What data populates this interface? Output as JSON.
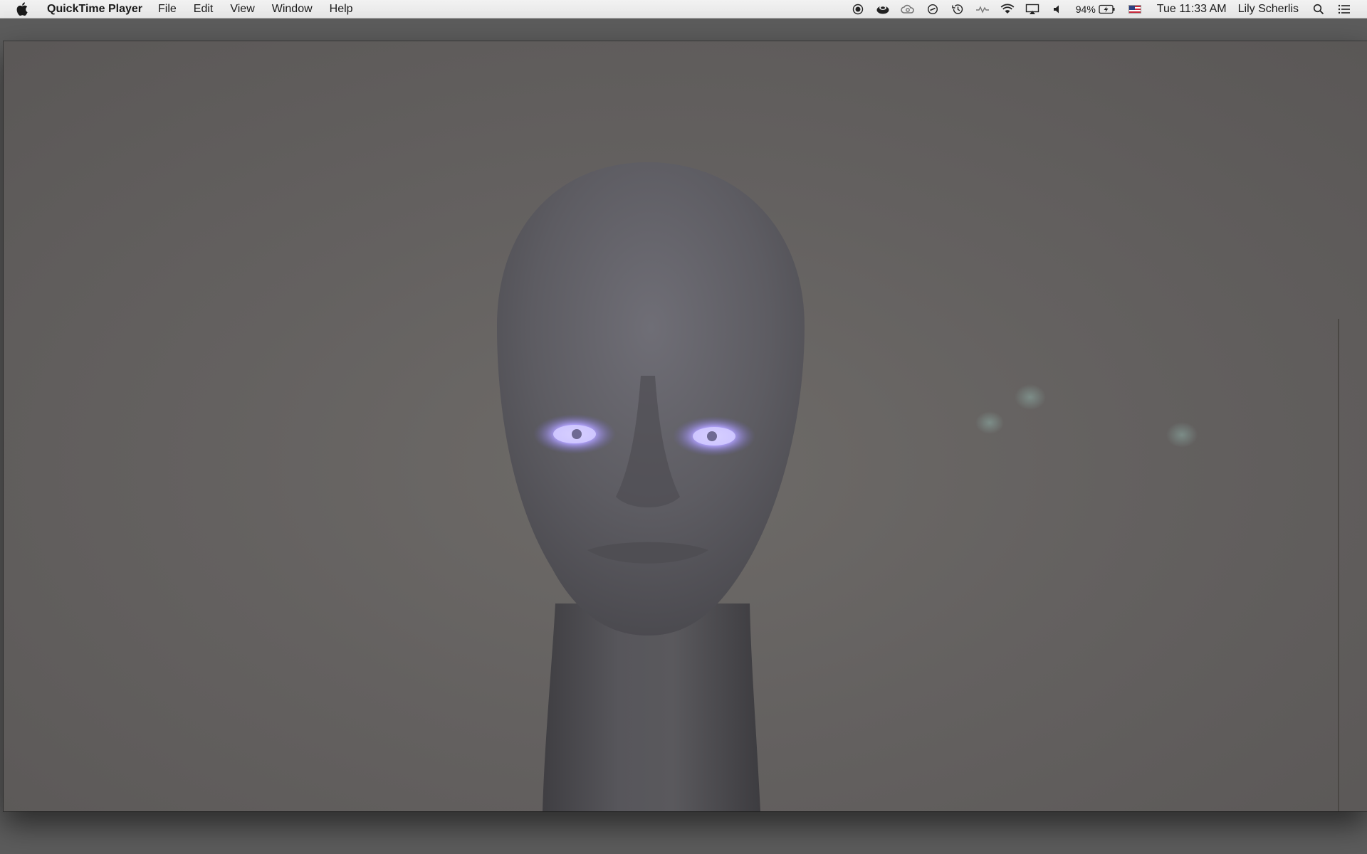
{
  "menubar": {
    "app_name": "QuickTime Player",
    "menus": [
      "File",
      "Edit",
      "View",
      "Window",
      "Help"
    ],
    "status": {
      "battery_percent": "94%",
      "clock": "Tue 11:33 AM",
      "user_name": "Lily Scherlis"
    },
    "icons": [
      "apple-icon",
      "record-icon",
      "evernote-icon",
      "creative-cloud-icon",
      "sync-icon",
      "time-machine-icon",
      "activity-icon",
      "wifi-icon",
      "airplay-icon",
      "volume-icon",
      "battery-charging-icon",
      "us-flag-icon",
      "spotlight-search-icon",
      "notification-center-icon"
    ]
  },
  "video": {
    "content": "mannequin-head"
  },
  "colors": {
    "menubar_bg": "#ececec",
    "desktop_bg": "#5c5c5c",
    "video_bg": "#676461",
    "eye_glow": "#b9a8ff"
  }
}
